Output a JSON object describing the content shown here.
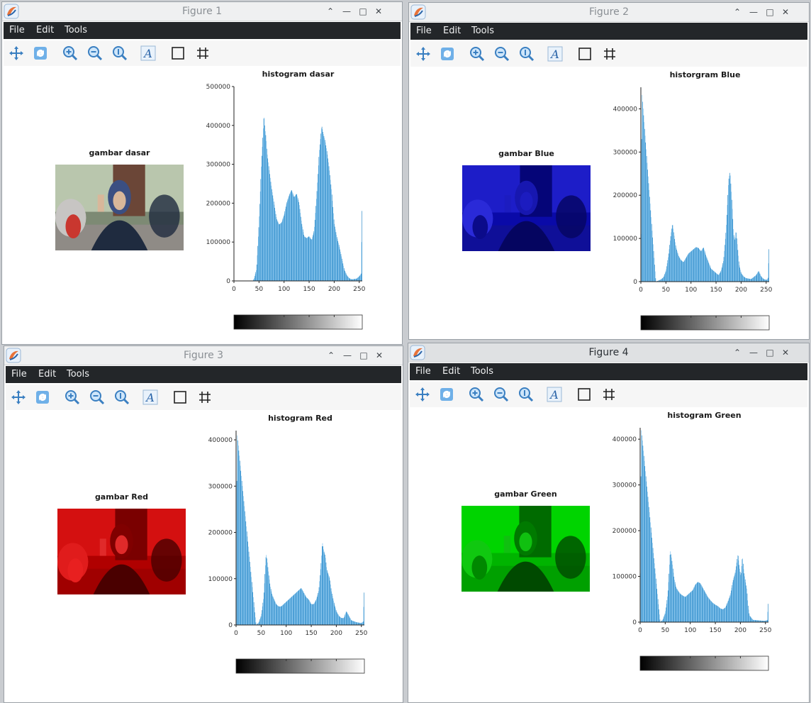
{
  "app": {
    "menu": [
      "File",
      "Edit",
      "Tools"
    ],
    "toolbar_icons": [
      "pan-icon",
      "rotate-icon",
      "zoom-in-icon",
      "zoom-out-icon",
      "zoom-reset-icon",
      "text-icon",
      "box-icon",
      "grid-icon"
    ]
  },
  "colors": {
    "bar": "#0072bd",
    "bar_edge": "#5fb3ea",
    "menubar": "#232629"
  },
  "figures": [
    {
      "title": "Figure 1",
      "image_title": "gambar dasar",
      "image_type": "original-photo",
      "chart_data": {
        "type": "bar",
        "title": "histogram dasar",
        "x_ticks": [
          "0",
          "50",
          "100",
          "150",
          "200",
          "250"
        ],
        "y_ticks": [
          "0",
          "100000",
          "200000",
          "300000",
          "400000",
          "500000"
        ],
        "xlim": [
          0,
          256
        ],
        "ylim": [
          0,
          500000
        ],
        "colorbar": "grayscale",
        "x": [
          37,
          40,
          45,
          50,
          55,
          58,
          60,
          62,
          64,
          66,
          70,
          75,
          80,
          85,
          90,
          95,
          100,
          105,
          110,
          115,
          120,
          125,
          130,
          135,
          140,
          145,
          150,
          155,
          160,
          165,
          170,
          175,
          178,
          182,
          186,
          190,
          195,
          200,
          205,
          210,
          215,
          220,
          225,
          230,
          235,
          240,
          245,
          250,
          252,
          254,
          255
        ],
        "y": [
          0,
          5000,
          30000,
          150000,
          310000,
          380000,
          430000,
          390000,
          370000,
          330000,
          290000,
          240000,
          200000,
          160000,
          145000,
          150000,
          170000,
          200000,
          220000,
          235000,
          215000,
          225000,
          200000,
          150000,
          115000,
          110000,
          115000,
          105000,
          130000,
          220000,
          330000,
          400000,
          380000,
          360000,
          330000,
          290000,
          230000,
          150000,
          115000,
          90000,
          60000,
          30000,
          15000,
          7000,
          4000,
          5000,
          6000,
          12000,
          15000,
          20000,
          180000
        ]
      }
    },
    {
      "title": "Figure 2",
      "image_title": "gambar Blue",
      "image_type": "blue-channel",
      "chart_data": {
        "type": "bar",
        "title": "historgram Blue",
        "x_ticks": [
          "0",
          "50",
          "100",
          "150",
          "200",
          "250"
        ],
        "y_ticks": [
          "0",
          "100000",
          "200000",
          "300000",
          "400000"
        ],
        "xlim": [
          0,
          256
        ],
        "ylim": [
          0,
          450000
        ],
        "colorbar": "grayscale",
        "x": [
          0,
          2,
          30,
          40,
          45,
          50,
          55,
          60,
          63,
          66,
          70,
          75,
          80,
          85,
          90,
          95,
          100,
          105,
          110,
          115,
          120,
          125,
          130,
          135,
          140,
          145,
          150,
          155,
          160,
          165,
          170,
          175,
          178,
          182,
          185,
          188,
          190,
          193,
          196,
          200,
          205,
          210,
          220,
          230,
          235,
          240,
          245,
          250,
          252,
          254,
          255
        ],
        "y": [
          0,
          440000,
          0,
          5000,
          10000,
          25000,
          60000,
          110000,
          135000,
          110000,
          80000,
          60000,
          50000,
          45000,
          55000,
          65000,
          70000,
          75000,
          80000,
          78000,
          70000,
          80000,
          60000,
          45000,
          30000,
          25000,
          20000,
          15000,
          25000,
          50000,
          120000,
          235000,
          255000,
          180000,
          110000,
          95000,
          120000,
          80000,
          40000,
          20000,
          12000,
          8000,
          6000,
          15000,
          25000,
          12000,
          6000,
          4000,
          5000,
          10000,
          75000
        ]
      }
    },
    {
      "title": "Figure 3",
      "image_title": "gambar Red",
      "image_type": "red-channel",
      "chart_data": {
        "type": "bar",
        "title": "histogram Red",
        "x_ticks": [
          "0",
          "50",
          "100",
          "150",
          "200",
          "250"
        ],
        "y_ticks": [
          "0",
          "100000",
          "200000",
          "300000",
          "400000"
        ],
        "xlim": [
          0,
          256
        ],
        "ylim": [
          0,
          420000
        ],
        "colorbar": "grayscale",
        "x": [
          0,
          2,
          40,
          45,
          50,
          55,
          58,
          60,
          62,
          64,
          68,
          72,
          76,
          80,
          85,
          90,
          95,
          100,
          105,
          110,
          115,
          120,
          125,
          130,
          135,
          140,
          145,
          150,
          155,
          160,
          165,
          170,
          172,
          175,
          178,
          181,
          184,
          187,
          190,
          195,
          200,
          205,
          210,
          215,
          220,
          225,
          230,
          240,
          250,
          254,
          255
        ],
        "y": [
          0,
          415000,
          0,
          5000,
          20000,
          60000,
          120000,
          155000,
          140000,
          120000,
          85000,
          65000,
          55000,
          45000,
          40000,
          40000,
          45000,
          50000,
          55000,
          60000,
          65000,
          70000,
          75000,
          80000,
          70000,
          60000,
          55000,
          45000,
          45000,
          55000,
          75000,
          140000,
          180000,
          160000,
          150000,
          120000,
          110000,
          100000,
          75000,
          50000,
          30000,
          20000,
          15000,
          15000,
          30000,
          20000,
          10000,
          6000,
          4000,
          8000,
          70000
        ]
      }
    },
    {
      "title": "Figure 4",
      "image_title": "gambar Green",
      "image_type": "green-channel",
      "chart_data": {
        "type": "bar",
        "title": "histogram Green",
        "x_ticks": [
          "0",
          "50",
          "100",
          "150",
          "200",
          "250"
        ],
        "y_ticks": [
          "0",
          "100000",
          "200000",
          "300000",
          "400000"
        ],
        "xlim": [
          0,
          256
        ],
        "ylim": [
          0,
          425000
        ],
        "colorbar": "grayscale",
        "x": [
          0,
          2,
          40,
          45,
          50,
          55,
          58,
          60,
          62,
          64,
          68,
          72,
          76,
          80,
          85,
          90,
          95,
          100,
          105,
          110,
          115,
          120,
          125,
          130,
          135,
          140,
          145,
          150,
          155,
          160,
          165,
          170,
          175,
          180,
          185,
          190,
          195,
          198,
          201,
          204,
          207,
          210,
          213,
          215,
          218,
          225,
          235,
          245,
          250,
          254,
          255
        ],
        "y": [
          0,
          425000,
          0,
          5000,
          20000,
          60000,
          115000,
          158000,
          145000,
          130000,
          95000,
          75000,
          68000,
          62000,
          58000,
          55000,
          60000,
          65000,
          70000,
          82000,
          88000,
          85000,
          75000,
          65000,
          55000,
          48000,
          42000,
          38000,
          35000,
          30000,
          28000,
          32000,
          45000,
          60000,
          90000,
          110000,
          150000,
          120000,
          100000,
          145000,
          110000,
          90000,
          70000,
          40000,
          15000,
          5000,
          4000,
          3000,
          3000,
          5000,
          40000
        ]
      }
    }
  ]
}
